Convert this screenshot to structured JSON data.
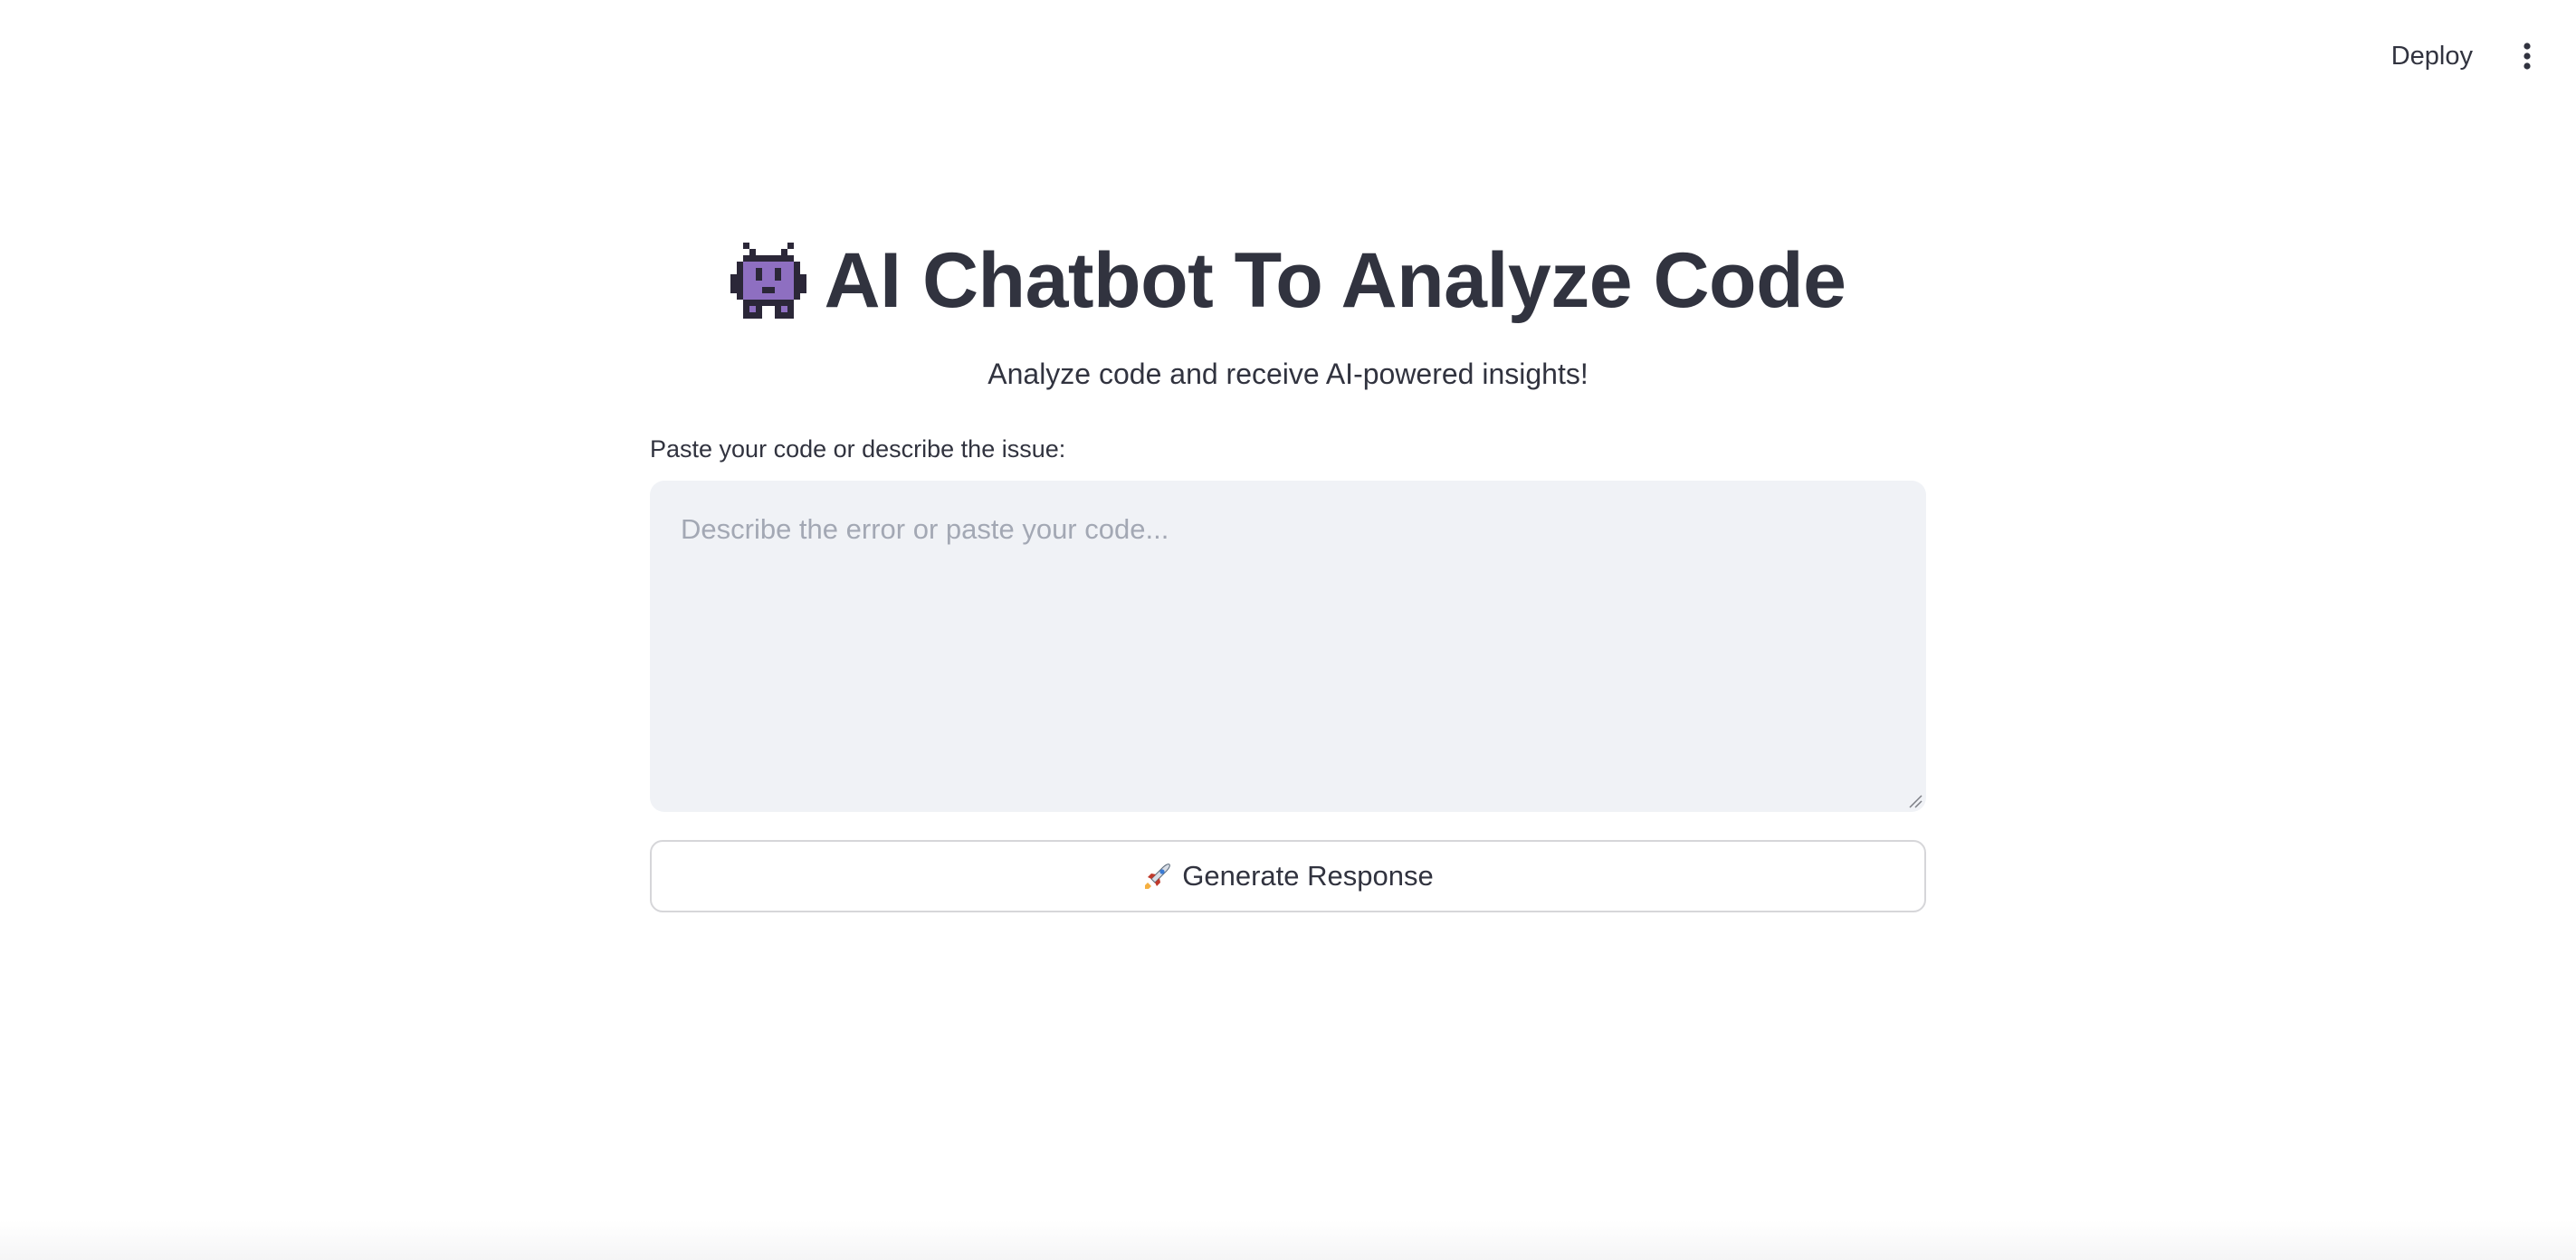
{
  "header": {
    "deploy_label": "Deploy",
    "menu_icon": "more-vertical-icon"
  },
  "main": {
    "title_icon": "alien-monster-icon",
    "title": "AI Chatbot To Analyze Code",
    "subtitle": "Analyze code and receive AI-powered insights!",
    "input": {
      "label": "Paste your code or describe the issue:",
      "placeholder": "Describe the error or paste your code...",
      "value": ""
    },
    "generate_button": {
      "icon": "rocket-icon",
      "label": "Generate Response"
    }
  },
  "colors": {
    "text": "#31333f",
    "input_background": "#f0f2f6",
    "placeholder": "#a3a8b4",
    "button_border": "#d6d6d9",
    "icon_purple": "#8e6fc1"
  }
}
